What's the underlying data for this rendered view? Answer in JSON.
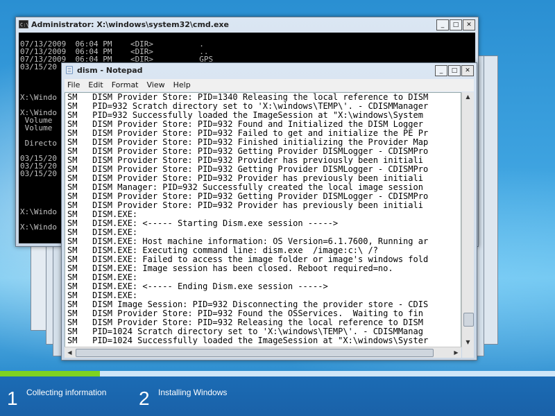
{
  "cmd_window": {
    "title": "Administrator: X:\\windows\\system32\\cmd.exe",
    "lines": [
      "",
      "07/13/2009  06:04 PM    <DIR>          .",
      "07/13/2009  06:04 PM    <DIR>          ..",
      "07/13/2009  06:04 PM    <DIR>          GPS",
      "03/15/20",
      "",
      "",
      "",
      "X:\\Windo",
      "",
      "X:\\Windo",
      " Volume ",
      " Volume ",
      "",
      " Directo",
      "",
      "03/15/20",
      "03/15/20",
      "03/15/20",
      "",
      "",
      "",
      "",
      "X:\\Windo",
      "",
      "X:\\Windo"
    ]
  },
  "notepad": {
    "title": "dism - Notepad",
    "menu": [
      "File",
      "Edit",
      "Format",
      "View",
      "Help"
    ],
    "lines": [
      "SM   DISM Provider Store: PID=1340 Releasing the local reference to DISM",
      "SM   PID=932 Scratch directory set to 'X:\\windows\\TEMP\\'. - CDISMManager",
      "SM   PID=932 Successfully loaded the ImageSession at \"X:\\windows\\System",
      "SM   DISM Provider Store: PID=932 Found and Initialized the DISM Logger",
      "SM   DISM Provider Store: PID=932 Failed to get and initialize the PE Pr",
      "SM   DISM Provider Store: PID=932 Finished initializing the Provider Map",
      "SM   DISM Provider Store: PID=932 Getting Provider DISMLogger - CDISMPro",
      "SM   DISM Provider Store: PID=932 Provider has previously been initiali",
      "SM   DISM Provider Store: PID=932 Getting Provider DISMLogger - CDISMPro",
      "SM   DISM Provider Store: PID=932 Provider has previously been initiali",
      "SM   DISM Manager: PID=932 Successfully created the local image session",
      "SM   DISM Provider Store: PID=932 Getting Provider DISMLogger - CDISMPro",
      "SM   DISM Provider Store: PID=932 Provider has previously been initiali",
      "SM   DISM.EXE:",
      "SM   DISM.EXE: <----- Starting Dism.exe session ----->",
      "SM   DISM.EXE:",
      "SM   DISM.EXE: Host machine information: OS Version=6.1.7600, Running ar",
      "SM   DISM.EXE: Executing command line: dism.exe  /image:c:\\ /?",
      "SM   DISM.EXE: Failed to access the image folder or image's windows fold",
      "SM   DISM.EXE: Image session has been closed. Reboot required=no.",
      "SM   DISM.EXE:",
      "SM   DISM.EXE: <----- Ending Dism.exe session ----->",
      "SM   DISM.EXE:",
      "SM   DISM Image Session: PID=932 Disconnecting the provider store - CDIS",
      "SM   DISM Provider Store: PID=932 Found the OSServices.  Waiting to fin",
      "SM   DISM Provider Store: PID=932 Releasing the local reference to DISM",
      "SM   PID=1024 Scratch directory set to 'X:\\windows\\TEMP\\'. - CDISMManag",
      "SM   PID=1024 Successfully loaded the ImageSession at \"X:\\windows\\Syster"
    ]
  },
  "setup": {
    "progress": 0.18,
    "steps": [
      {
        "number": "1",
        "label": "Collecting information"
      },
      {
        "number": "2",
        "label": "Installing Windows"
      }
    ]
  }
}
